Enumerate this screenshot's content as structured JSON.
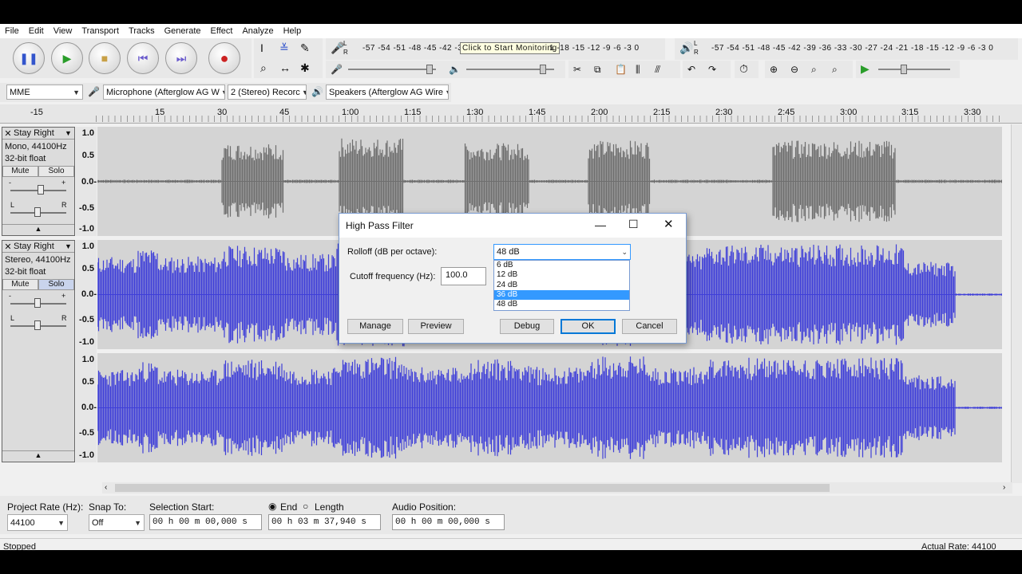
{
  "menu": [
    "File",
    "Edit",
    "View",
    "Transport",
    "Tracks",
    "Generate",
    "Effect",
    "Analyze",
    "Help"
  ],
  "meters": {
    "rec_scale": "-57 -54 -51 -48 -45 -42 -3",
    "rec_tooltip": "Click to Start Monitoring",
    "rec_scale_tail": "1 -18 -15 -12  -9  -6  -3  0",
    "play_scale": "-57 -54 -51 -48 -45 -42 -39 -36 -33 -30 -27 -24 -21 -18 -15 -12  -9  -6  -3  0",
    "lr_l": "L",
    "lr_r": "R"
  },
  "device": {
    "host": "MME",
    "mic": "Microphone (Afterglow AG W",
    "channels": "2 (Stereo) Recorc",
    "speaker": "Speakers (Afterglow AG Wire"
  },
  "ruler": [
    "-15",
    "15",
    "30",
    "45",
    "1:00",
    "1:15",
    "1:30",
    "1:45",
    "2:00",
    "2:15",
    "2:30",
    "2:45",
    "3:00",
    "3:15",
    "3:30"
  ],
  "tracks": [
    {
      "name": "Stay Right",
      "info1": "Mono, 44100Hz",
      "info2": "32-bit float",
      "mute": "Mute",
      "solo": "Solo",
      "scale": [
        "1.0",
        "0.5",
        "0.0-",
        "-0.5",
        "-1.0"
      ]
    },
    {
      "name": "Stay Right",
      "info1": "Stereo, 44100Hz",
      "info2": "32-bit float",
      "mute": "Mute",
      "solo": "Solo",
      "scale": [
        "1.0",
        "0.5",
        "0.0-",
        "-0.5",
        "-1.0"
      ],
      "scale2": [
        "1.0",
        "0.5",
        "0.0-",
        "-0.5",
        "-1.0"
      ]
    }
  ],
  "gain_minus": "-",
  "gain_plus": "+",
  "pan_l": "L",
  "pan_r": "R",
  "dialog": {
    "title": "High Pass Filter",
    "rolloff_label": "Rolloff (dB per octave):",
    "rolloff_value": "48 dB",
    "rolloff_options": [
      "6 dB",
      "12 dB",
      "24 dB",
      "36 dB",
      "48 dB"
    ],
    "rolloff_highlighted": "36 dB",
    "cutoff_label": "Cutoff frequency (Hz):",
    "cutoff_value": "100.0",
    "buttons": {
      "manage": "Manage",
      "preview": "Preview",
      "debug": "Debug",
      "ok": "OK",
      "cancel": "Cancel"
    }
  },
  "selection": {
    "rate_label": "Project Rate (Hz):",
    "rate_value": "44100",
    "snap_label": "Snap To:",
    "snap_value": "Off",
    "start_label": "Selection Start:",
    "start_value": "00 h 00 m 00,000 s",
    "end_label": "End",
    "length_label": "Length",
    "end_value": "00 h 03 m 37,940 s",
    "pos_label": "Audio Position:",
    "pos_value": "00 h 00 m 00,000 s"
  },
  "status": {
    "left": "Stopped",
    "right": "Actual Rate: 44100"
  },
  "colors": {
    "wave_gray": "#6e6e6e",
    "wave_blue": "#3f3fd8",
    "selection": "#3399ff"
  }
}
